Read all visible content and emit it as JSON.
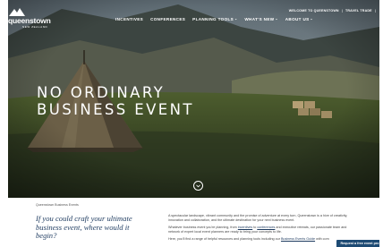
{
  "brand": {
    "logo_word": "queenstown",
    "logo_sub": "NEW ZEALAND"
  },
  "utility_nav": {
    "welcome": "WELCOME TO QUEENSTOWN",
    "trade": "TRAVEL TRADE"
  },
  "main_nav": [
    {
      "label": "INCENTIVES",
      "has_dropdown": false
    },
    {
      "label": "CONFERENCES",
      "has_dropdown": false
    },
    {
      "label": "PLANNING TOOLS",
      "has_dropdown": true
    },
    {
      "label": "WHAT'S NEW",
      "has_dropdown": true
    },
    {
      "label": "ABOUT US",
      "has_dropdown": true
    }
  ],
  "hero": {
    "title_line1": "NO ORDINARY",
    "title_line2": "BUSINESS EVENT"
  },
  "breadcrumb": "Queenstown Business Events",
  "headline": {
    "line1": "If you could craft your ultimate",
    "line2": "business event, where would it",
    "line3": "begin?"
  },
  "body": {
    "p1_line1": "A spectacular landscape, vibrant community and the promise of adventure at every turn, Queenstown is a hive of creativity,",
    "p1_line2": "innovation and collaboration, and the ultimate destination for your next business event.",
    "p2_pre": "Whatever business event you're planning, from ",
    "p2_link1": "incentives",
    "p2_mid": " to ",
    "p2_link2": "conferences",
    "p2_post": " and executive retreats, our passionate team and",
    "p2_line2": "network of expert local event planners are ready to bring your concepts to life.",
    "p3_pre": "Here, you'll find a range of helpful resources and planning tools including our ",
    "p3_link": "Business Events Guide",
    "p3_post": " with com"
  },
  "cta": {
    "label": "Request a free event pro"
  },
  "colors": {
    "brand_navy": "#1d3a5f",
    "cta_blue": "#1d4a73"
  },
  "icons": {
    "scroll": "chevron-down-icon",
    "dropdown": "chevron-down-icon"
  }
}
